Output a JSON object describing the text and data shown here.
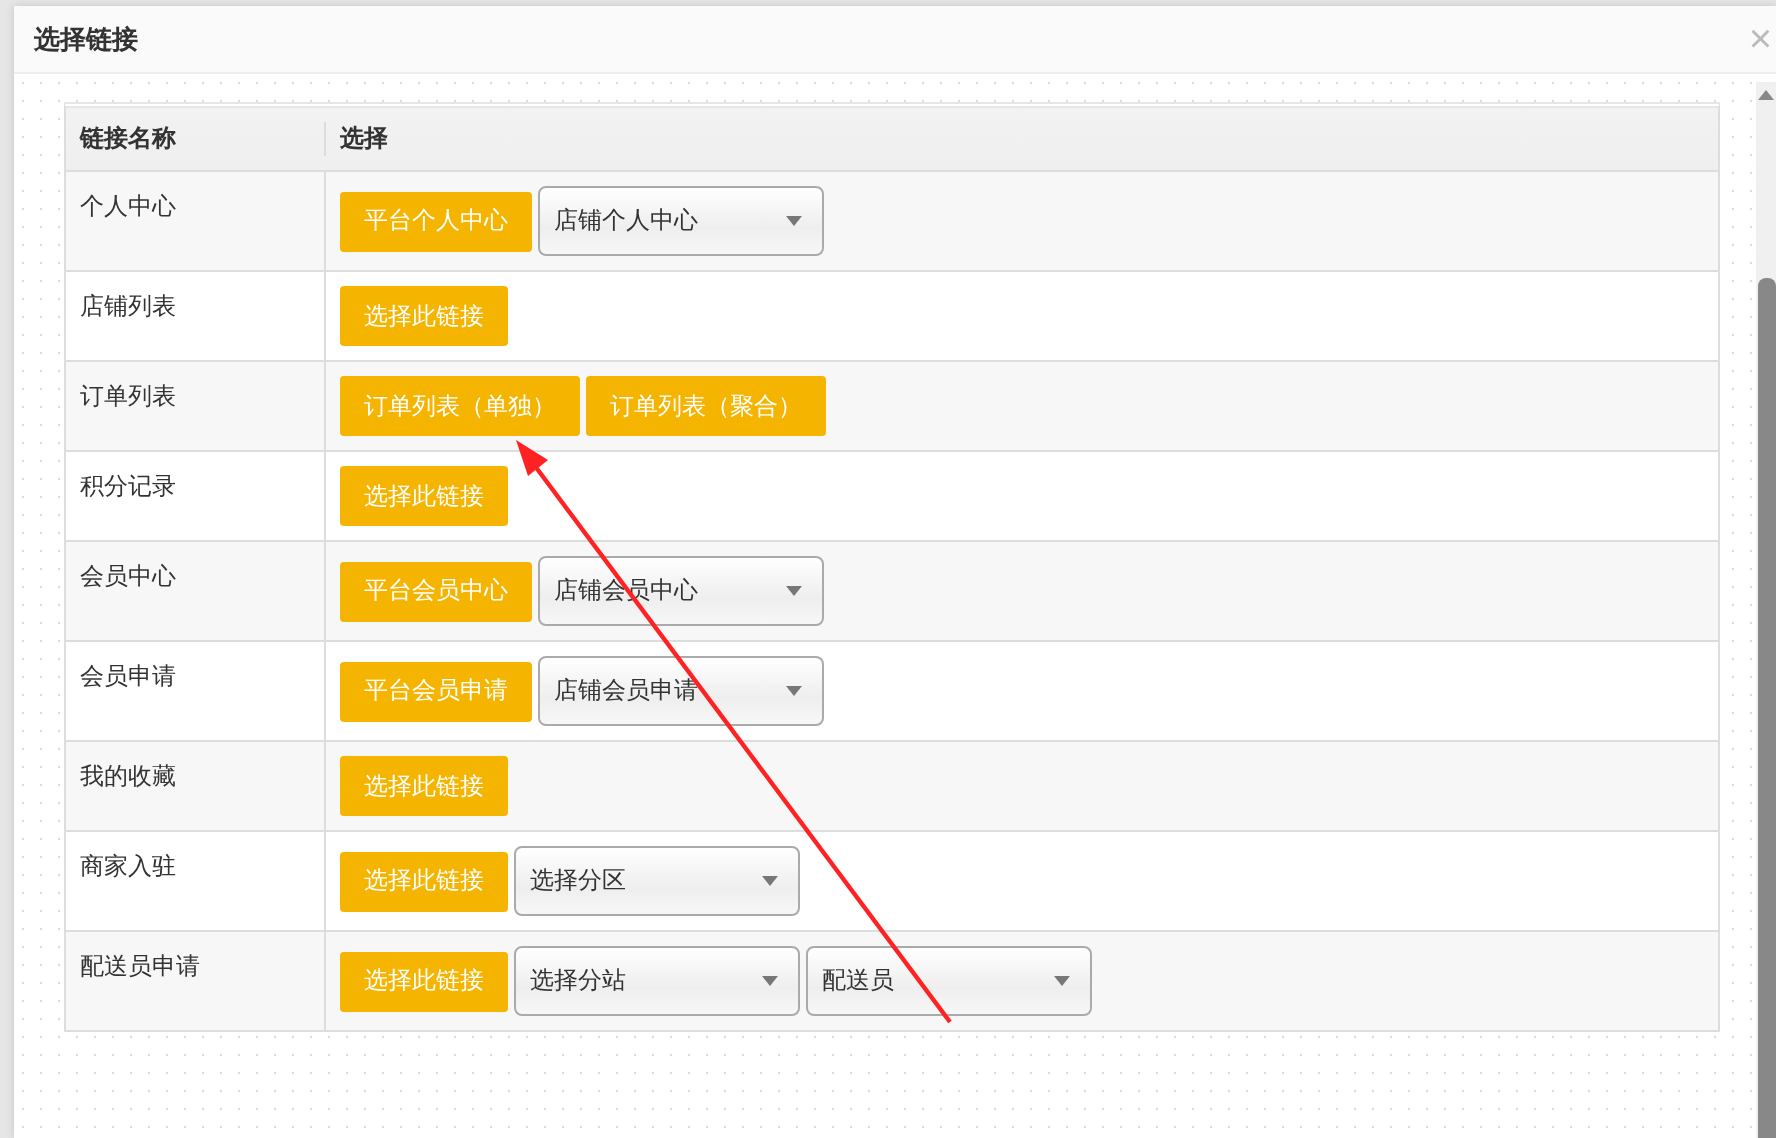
{
  "dialog": {
    "title": "选择链接",
    "close": "×"
  },
  "table": {
    "columns": [
      "链接名称",
      "选择"
    ],
    "rows": [
      {
        "name": "个人中心",
        "controls": [
          {
            "kind": "button",
            "text": "平台个人中心"
          },
          {
            "kind": "select",
            "text": "店铺个人中心"
          }
        ]
      },
      {
        "name": "店铺列表",
        "controls": [
          {
            "kind": "button",
            "text": "选择此链接"
          }
        ]
      },
      {
        "name": "订单列表",
        "controls": [
          {
            "kind": "button",
            "text": "订单列表（单独）"
          },
          {
            "kind": "button",
            "text": "订单列表（聚合）"
          }
        ]
      },
      {
        "name": "积分记录",
        "controls": [
          {
            "kind": "button",
            "text": "选择此链接"
          }
        ]
      },
      {
        "name": "会员中心",
        "controls": [
          {
            "kind": "button",
            "text": "平台会员中心"
          },
          {
            "kind": "select",
            "text": "店铺会员中心"
          }
        ]
      },
      {
        "name": "会员申请",
        "controls": [
          {
            "kind": "button",
            "text": "平台会员申请"
          },
          {
            "kind": "select",
            "text": "店铺会员申请"
          }
        ]
      },
      {
        "name": "我的收藏",
        "controls": [
          {
            "kind": "button",
            "text": "选择此链接"
          }
        ]
      },
      {
        "name": "商家入驻",
        "controls": [
          {
            "kind": "button",
            "text": "选择此链接"
          },
          {
            "kind": "select",
            "text": "选择分区"
          }
        ]
      },
      {
        "name": "配送员申请",
        "controls": [
          {
            "kind": "button",
            "text": "选择此链接"
          },
          {
            "kind": "select",
            "text": "选择分站"
          },
          {
            "kind": "select",
            "text": "配送员"
          }
        ]
      }
    ]
  }
}
